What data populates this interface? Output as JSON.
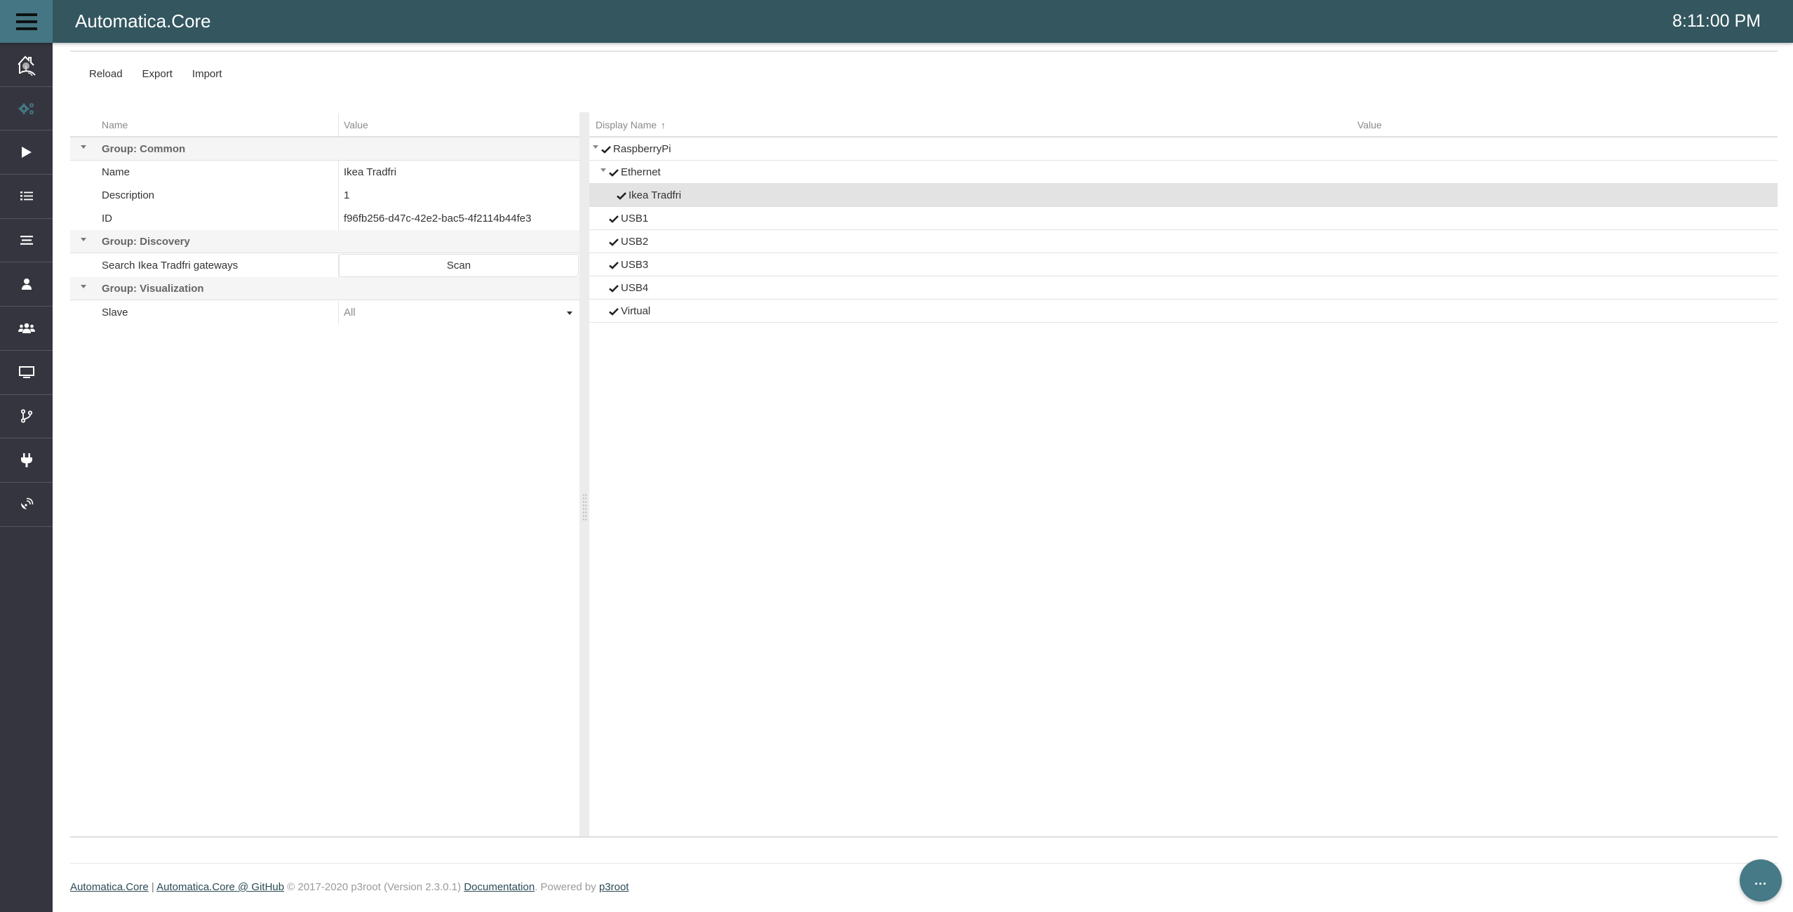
{
  "header": {
    "title": "Automatica.Core",
    "clock": "8:11:00 PM",
    "menu_icon": "hamburger-icon"
  },
  "sidebar": {
    "items": [
      {
        "name": "home",
        "icon": "smart-home-logo-icon",
        "active": false
      },
      {
        "name": "configuration",
        "icon": "gears-icon",
        "active": true
      },
      {
        "name": "rules",
        "icon": "play-icon",
        "active": false
      },
      {
        "name": "categories",
        "icon": "list-icon",
        "active": false
      },
      {
        "name": "areas",
        "icon": "align-lines-icon",
        "active": false
      },
      {
        "name": "user",
        "icon": "user-icon",
        "active": false
      },
      {
        "name": "groups",
        "icon": "users-icon",
        "active": false
      },
      {
        "name": "visualization",
        "icon": "monitor-icon",
        "active": false
      },
      {
        "name": "logic",
        "icon": "branch-icon",
        "active": false
      },
      {
        "name": "plugins",
        "icon": "plug-icon",
        "active": false
      },
      {
        "name": "satellite",
        "icon": "satellite-dish-icon",
        "active": false
      }
    ],
    "accent": "#457683"
  },
  "toolbar": {
    "reload": "Reload",
    "export": "Export",
    "import": "Import"
  },
  "properties": {
    "columns": {
      "name": "Name",
      "value": "Value"
    },
    "groups": [
      {
        "title": "Group: Common",
        "rows": [
          {
            "label": "Name",
            "value": "Ikea Tradfri"
          },
          {
            "label": "Description",
            "value": "1"
          },
          {
            "label": "ID",
            "value": "f96fb256-d47c-42e2-bac5-4f2114b44fe3"
          }
        ]
      },
      {
        "title": "Group: Discovery",
        "rows": [
          {
            "label": "Search Ikea Tradfri gateways",
            "button": "Scan"
          }
        ]
      },
      {
        "title": "Group: Visualization",
        "rows": [
          {
            "label": "Slave",
            "select": "All"
          }
        ]
      }
    ]
  },
  "tree": {
    "columns": {
      "display_name": "Display Name",
      "value": "Value",
      "sort": "ascending"
    },
    "nodes": [
      {
        "label": "RaspberryPi",
        "level": 0,
        "expanded": true,
        "checked": true,
        "selected": false
      },
      {
        "label": "Ethernet",
        "level": 1,
        "expanded": true,
        "checked": true,
        "selected": false
      },
      {
        "label": "Ikea Tradfri",
        "level": 2,
        "expanded": null,
        "checked": true,
        "selected": true
      },
      {
        "label": "USB1",
        "level": 1,
        "expanded": null,
        "checked": true,
        "selected": false
      },
      {
        "label": "USB2",
        "level": 1,
        "expanded": null,
        "checked": true,
        "selected": false
      },
      {
        "label": "USB3",
        "level": 1,
        "expanded": null,
        "checked": true,
        "selected": false
      },
      {
        "label": "USB4",
        "level": 1,
        "expanded": null,
        "checked": true,
        "selected": false
      },
      {
        "label": "Virtual",
        "level": 1,
        "expanded": null,
        "checked": true,
        "selected": false
      }
    ]
  },
  "footer": {
    "link1": "Automatica.Core",
    "separator": " | ",
    "link2": "Automatica.Core @ GitHub",
    "copyright": " © 2017-2020 p3root (Version 2.3.0.1) ",
    "link3": "Documentation",
    "powered": ". Powered by ",
    "link4": "p3root"
  },
  "fab": {
    "label": "..."
  },
  "colors": {
    "header": "#33565f",
    "sidebar": "#35353f",
    "accent": "#457683",
    "selected_row": "#e3e3e3",
    "group_row": "#f5f5f5"
  }
}
